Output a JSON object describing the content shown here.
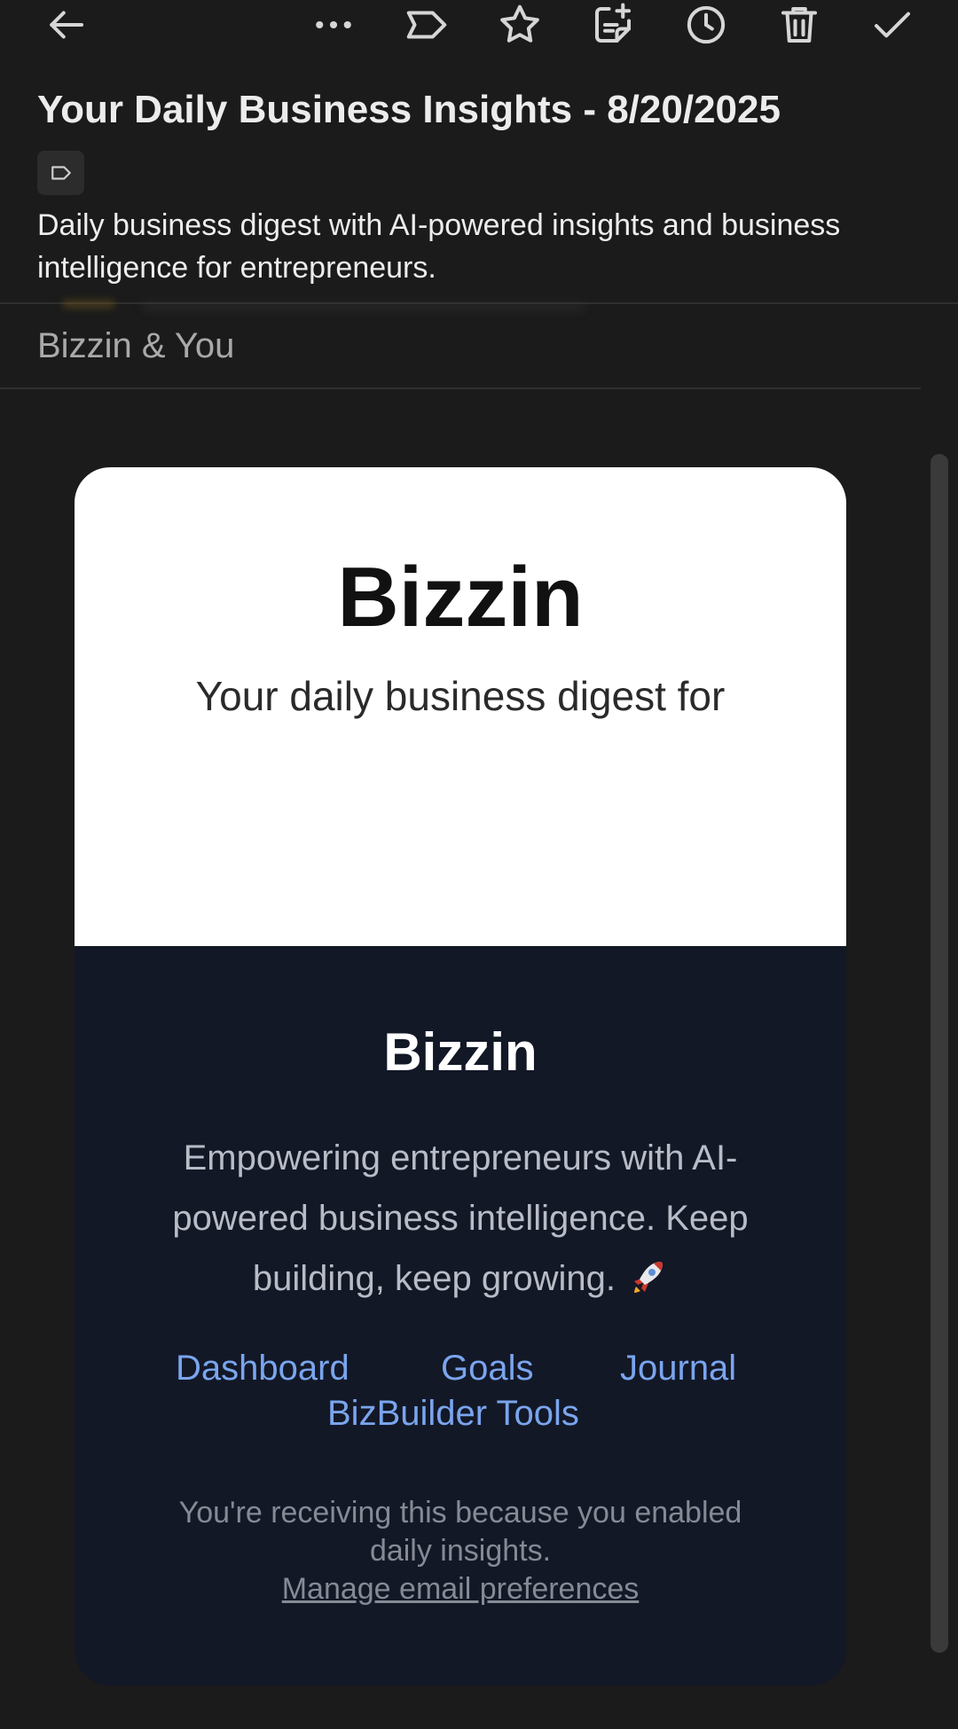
{
  "toolbar": {
    "icons": [
      "back-arrow-icon",
      "more-icon",
      "label-icon",
      "star-icon",
      "add-note-icon",
      "snooze-icon",
      "trash-icon",
      "done-check-icon"
    ]
  },
  "header": {
    "subject": "Your Daily Business Insights - 8/20/2025",
    "summary": "Daily business digest with AI-powered insights and business intelligence for entrepreneurs.",
    "participants": "Bizzin & You"
  },
  "email": {
    "brand": "Bizzin",
    "subtitle": "Your daily business digest for",
    "footer": {
      "title": "Bizzin",
      "tagline": "Empowering entrepreneurs with AI-powered business intelligence. Keep building, keep growing.",
      "links": [
        "Dashboard",
        "Goals",
        "Journal",
        "BizBuilder Tools"
      ],
      "legal": "You're receiving this because you enabled daily insights.",
      "manage": "Manage email preferences"
    }
  },
  "colors": {
    "background": "#1b1b1b",
    "card_footer": "#131827",
    "link": "#7aa5ee"
  }
}
